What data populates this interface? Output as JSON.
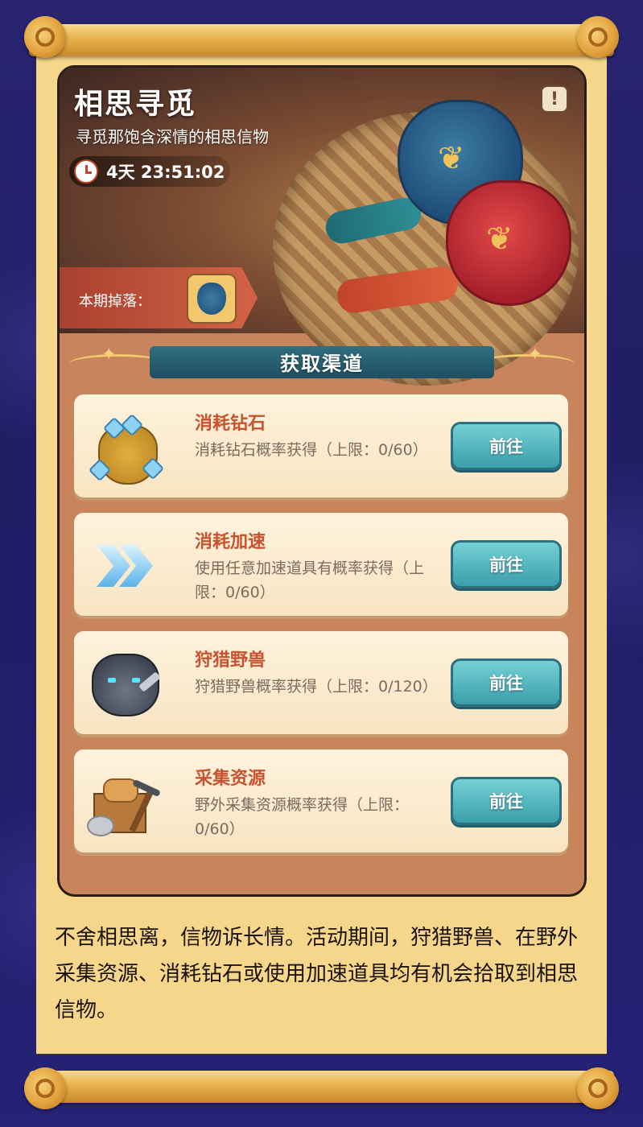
{
  "hero": {
    "title": "相思寻觅",
    "subtitle": "寻觅那饱含深情的相思信物",
    "timer": "4天 23:51:02",
    "info": "!",
    "drop_label": "本期掉落："
  },
  "section_title": "获取渠道",
  "channels": [
    {
      "title": "消耗钻石",
      "desc": "消耗钻石概率获得（上限：0/60）",
      "button": "前往",
      "icon": "diamond-sack-icon"
    },
    {
      "title": "消耗加速",
      "desc": "使用任意加速道具有概率获得（上限：0/60）",
      "button": "前往",
      "icon": "speedup-chevron-icon"
    },
    {
      "title": "狩猎野兽",
      "desc": "狩猎野兽概率获得（上限：0/120）",
      "button": "前往",
      "icon": "wolf-beast-icon"
    },
    {
      "title": "采集资源",
      "desc": "野外采集资源概率获得（上限：0/60）",
      "button": "前往",
      "icon": "resource-gather-icon"
    }
  ],
  "description": "不舍相思离，信物诉长情。活动期间，狩猎野兽、在野外采集资源、消耗钻石或使用加速道具均有机会拾取到相思信物。",
  "colors": {
    "accent_red": "#c8532f",
    "button_teal": "#3c9fab",
    "background": "#1f1d63",
    "paper": "#f5d68a"
  }
}
